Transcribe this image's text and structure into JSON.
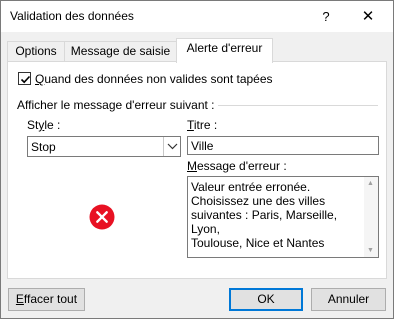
{
  "window": {
    "title": "Validation des données",
    "help_glyph": "?",
    "close_glyph": "✕"
  },
  "tabs": [
    {
      "label": "Options"
    },
    {
      "label": "Message de saisie"
    },
    {
      "label": "Alerte d'erreur",
      "active": true
    }
  ],
  "panel": {
    "show_alert": {
      "checked": true,
      "label_u": "Q",
      "label_rest": "uand des données non valides sont tapées"
    },
    "section_label": "Afficher le message d'erreur suivant :",
    "style": {
      "label_pre": "St",
      "label_u": "y",
      "label_post": "le :",
      "value": "Stop",
      "icon": "error-stop-icon"
    },
    "title_field": {
      "label_u": "T",
      "label_rest": "itre :",
      "value": "Ville"
    },
    "message_field": {
      "label_u": "M",
      "label_rest": "essage d'erreur :",
      "line1": "Valeur entrée erronée.",
      "line2": "Choisissez une des villes",
      "line3": "suivantes : Paris, Marseille, Lyon,",
      "line4": "Toulouse, Nice et Nantes"
    }
  },
  "buttons": {
    "clear_u": "E",
    "clear_rest": "ffacer tout",
    "ok": "OK",
    "cancel": "Annuler"
  },
  "colors": {
    "error_red": "#e81123",
    "focus_blue": "#0078d7"
  }
}
